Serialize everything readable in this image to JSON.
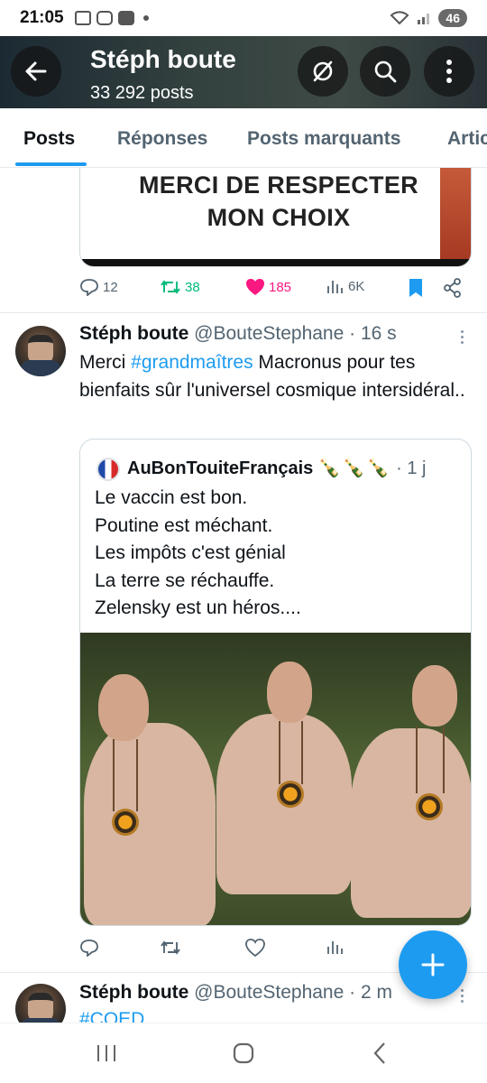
{
  "status_bar": {
    "time": "21:05",
    "battery": "46",
    "icons": [
      "screenshot-icon",
      "app-icon",
      "youtube-icon",
      "dot-icon",
      "wifi-icon",
      "signal-icon"
    ]
  },
  "header": {
    "title": "Stéph boute",
    "subtitle": "33 292 posts"
  },
  "tabs": [
    {
      "label": "Posts",
      "active": true
    },
    {
      "label": "Réponses",
      "active": false
    },
    {
      "label": "Posts marquants",
      "active": false
    },
    {
      "label": "Artic",
      "active": false
    }
  ],
  "previous_post": {
    "media_text_line1": "MERCI DE RESPECTER",
    "media_text_line2": "MON CHOIX",
    "replies": "12",
    "reposts": "38",
    "likes": "185",
    "views": "6K"
  },
  "post": {
    "author": "Stéph boute",
    "handle": "@BouteStephane",
    "time": "· 16 s",
    "text_before": "Merci ",
    "hashtag": "#grandmaîtres",
    "text_after": " Macronus pour tes bienfaits sûr l'universel cosmique intersidéral..",
    "quote": {
      "author": "AuBonTouiteFrançais",
      "emoji": "🍾🍾🍾",
      "time": "· 1 j",
      "lines": [
        "Le vaccin est bon.",
        "Poutine est méchant.",
        "Les impôts c'est génial",
        "La terre se réchauffe.",
        "Zelensky est un héros...."
      ]
    }
  },
  "next_post": {
    "author": "Stéph boute",
    "handle": "@BouteStephane",
    "time": "· 2 m",
    "text": "#COED"
  },
  "colors": {
    "accent": "#1d9bf0",
    "repost": "#00ba7c",
    "like": "#f91880",
    "muted": "#536471"
  }
}
